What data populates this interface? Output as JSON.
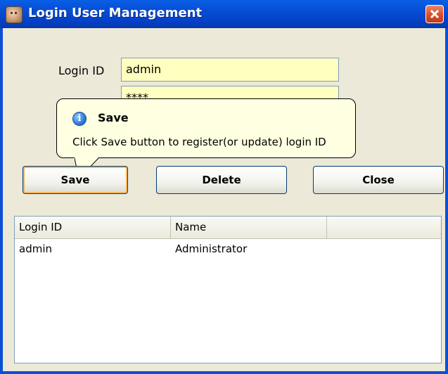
{
  "window": {
    "title": "Login User Management",
    "colors": {
      "titlebar": "#0751d9",
      "field_bg": "#ffffc0",
      "tooltip_bg": "#ffffe1"
    },
    "icons": {
      "app": "user-face-icon",
      "close": "close-icon",
      "info": "info-icon"
    }
  },
  "form": {
    "login_id_label": "Login ID",
    "login_id_value": "admin",
    "password_value": "****"
  },
  "tooltip": {
    "title": "Save",
    "body": "Click Save button to register(or update) login ID"
  },
  "buttons": {
    "save": "Save",
    "delete": "Delete",
    "close": "Close"
  },
  "list": {
    "columns": [
      "Login ID",
      "Name",
      ""
    ],
    "rows": [
      {
        "login_id": "admin",
        "name": "Administrator"
      }
    ]
  }
}
